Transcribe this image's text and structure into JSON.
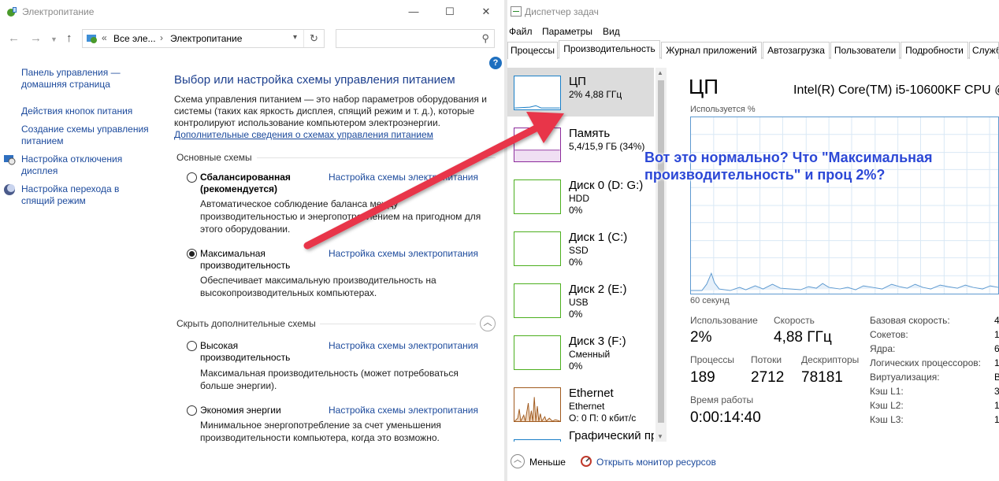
{
  "power": {
    "title": "Электропитание",
    "address": {
      "prefix": "«",
      "crumb1": "Все эле...",
      "crumb2": "Электропитание"
    },
    "search": {
      "placeholder": ""
    },
    "help": "?",
    "sidebar": [
      {
        "label": "Панель управления — домашняя страница"
      },
      {
        "label": "Действия кнопок питания"
      },
      {
        "label": "Создание схемы управления питанием"
      },
      {
        "label": "Настройка отключения дисплея"
      },
      {
        "label": "Настройка перехода в спящий режим"
      }
    ],
    "heading": "Выбор или настройка схемы управления питанием",
    "description": "Схема управления питанием — это набор параметров оборудования и системы (таких как яркость дисплея, спящий режим и т. д.), которые контролируют использование компьютером электроэнергии.",
    "more_link": "Дополнительные сведения о схемах управления питанием",
    "section_main": "Основные схемы",
    "section_hidden": "Скрыть дополнительные схемы",
    "plan_link": "Настройка схемы электропитания",
    "plans": [
      {
        "name": "Сбалансированная (рекомендуется)",
        "desc": "Автоматическое соблюдение баланса между производительностью и энергопотреблением на пригодном для этого оборудовании.",
        "checked": false
      },
      {
        "name": "Максимальная производительность",
        "desc": "Обеспечивает максимальную производительность на высокопроизводительных компьютерах.",
        "checked": true
      },
      {
        "name": "Высокая производительность",
        "desc": "Максимальная производительность (может потребоваться больше энергии).",
        "checked": false
      },
      {
        "name": "Экономия энергии",
        "desc": "Минимальное энергопотребление за счет уменьшения производительности компьютера, когда это возможно.",
        "checked": false
      }
    ]
  },
  "taskmgr": {
    "title": "Диспетчер задач",
    "menu": [
      "Файл",
      "Параметры",
      "Вид"
    ],
    "tabs": [
      "Процессы",
      "Производительность",
      "Журнал приложений",
      "Автозагрузка",
      "Пользователи",
      "Подробности",
      "Служб"
    ],
    "active_tab": 1,
    "resources": [
      {
        "name": "ЦП",
        "line1": "2% 4,88 ГГц",
        "line2": "",
        "color": "#1a7fc7"
      },
      {
        "name": "Память",
        "line1": "5,4/15,9 ГБ (34%)",
        "line2": "",
        "color": "#8b2a9b"
      },
      {
        "name": "Диск 0 (D: G:)",
        "line1": "HDD",
        "line2": "0%",
        "color": "#4caf1e"
      },
      {
        "name": "Диск 1 (C:)",
        "line1": "SSD",
        "line2": "0%",
        "color": "#4caf1e"
      },
      {
        "name": "Диск 2 (E:)",
        "line1": "USB",
        "line2": "0%",
        "color": "#4caf1e"
      },
      {
        "name": "Диск 3 (F:)",
        "line1": "Сменный",
        "line2": "0%",
        "color": "#4caf1e"
      },
      {
        "name": "Ethernet",
        "line1": "Ethernet",
        "line2": "О: 0 П: 0 кбит/с",
        "color": "#a05a1e"
      },
      {
        "name": "Графический пр",
        "line1": "",
        "line2": "",
        "color": "#1a7fc7"
      }
    ],
    "cpu": {
      "heading": "ЦП",
      "model": "Intel(R) Core(TM) i5-10600KF CPU @",
      "usage_label": "Используется %",
      "time_label": "60 секунд",
      "stats": [
        {
          "label": "Использование",
          "value": "2%"
        },
        {
          "label": "Скорость",
          "value": "4,88 ГГц"
        },
        {
          "label": "Процессы",
          "value": "189"
        },
        {
          "label": "Потоки",
          "value": "2712"
        },
        {
          "label": "Дескрипторы",
          "value": "78181"
        },
        {
          "label": "Время работы",
          "value": "0:00:14:40"
        }
      ],
      "details": [
        {
          "key": "Базовая скорость:",
          "value": "4"
        },
        {
          "key": "Сокетов:",
          "value": "1"
        },
        {
          "key": "Ядра:",
          "value": "6"
        },
        {
          "key": "Логических процессоров:",
          "value": "1"
        },
        {
          "key": "Виртуализация:",
          "value": "В"
        },
        {
          "key": "Кэш L1:",
          "value": "3"
        },
        {
          "key": "Кэш L2:",
          "value": "1"
        },
        {
          "key": "Кэш L3:",
          "value": "1"
        }
      ]
    },
    "footer": {
      "fewer": "Меньше",
      "resmon": "Открыть монитор ресурсов"
    }
  },
  "annotation": "Вот это нормально? Что \"Максимальная производительность\" и проц 2%?",
  "colors": {
    "link": "#1c4a9c",
    "accent": "#2c48d6",
    "arrow": "#e8344a",
    "cpu_graph": "#5e9ad0"
  }
}
